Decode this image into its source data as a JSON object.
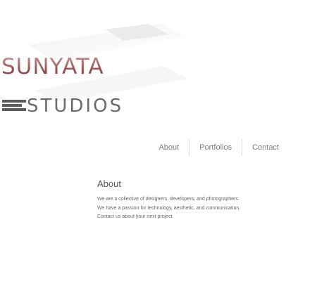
{
  "logo": {
    "word_top": "SUNYATA",
    "word_bottom": "STUDIOS"
  },
  "nav": {
    "items": [
      {
        "label": "About"
      },
      {
        "label": "Portfolios"
      },
      {
        "label": "Contact"
      }
    ]
  },
  "main": {
    "heading": "About",
    "lines": [
      "We are a collective of designers, developers, and photographers.",
      "We have a passion for technology, aesthetic, and communication.",
      "Contact us about your next project."
    ]
  },
  "colors": {
    "logo_top": "#9c5a5a",
    "logo_bottom": "#6b6b6b",
    "nav_text": "#7a7a7a",
    "body_text": "#666666"
  }
}
